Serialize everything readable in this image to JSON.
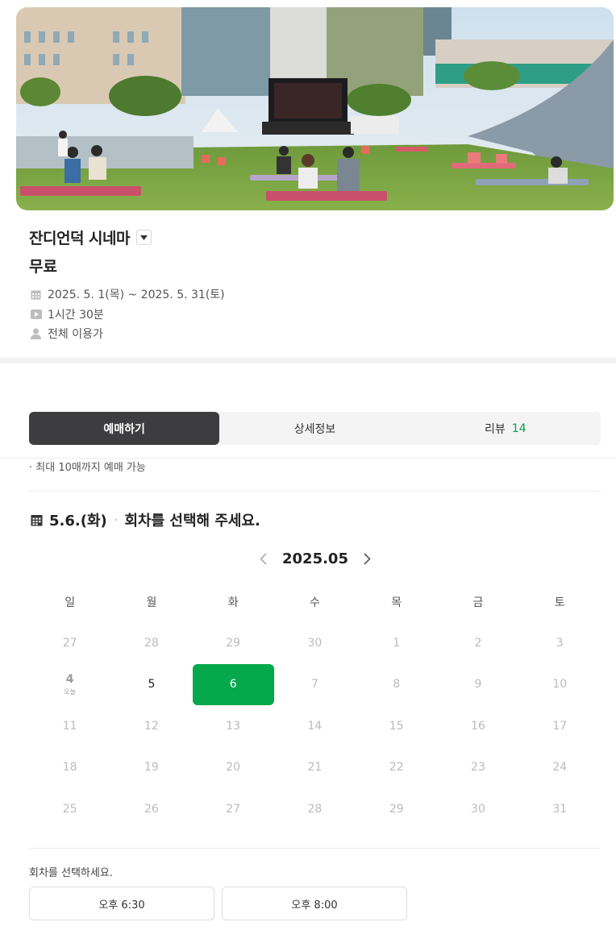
{
  "hero": {
    "image": "outdoor-cinema-lawn-photo"
  },
  "event": {
    "title": "잔디언덕 시네마",
    "price": "무료",
    "period": "2025. 5. 1(목) ~ 2025. 5. 31(토)",
    "runtime": "1시간 30분",
    "rating": "전체 이용가"
  },
  "tabs": [
    {
      "label": "예매하기",
      "active": true
    },
    {
      "label": "상세정보",
      "active": false
    },
    {
      "label": "리뷰",
      "count": "14",
      "active": false
    }
  ],
  "notice": "· 최대 10매까지 예매 가능",
  "selection": {
    "date": "5.6.(화)",
    "prompt": "회차를 선택해 주세요."
  },
  "calendar": {
    "month": "2025.05",
    "weekdays": [
      "일",
      "월",
      "화",
      "수",
      "목",
      "금",
      "토"
    ],
    "weeks": [
      [
        "27",
        "28",
        "29",
        "30",
        "1",
        "2",
        "3"
      ],
      [
        "4",
        "5",
        "6",
        "7",
        "8",
        "9",
        "10"
      ],
      [
        "11",
        "12",
        "13",
        "14",
        "15",
        "16",
        "17"
      ],
      [
        "18",
        "19",
        "20",
        "21",
        "22",
        "23",
        "24"
      ],
      [
        "25",
        "26",
        "27",
        "28",
        "29",
        "30",
        "31"
      ]
    ],
    "today_label": "오늘",
    "available": [
      "5",
      "6"
    ],
    "selected": "6",
    "accent": "#05a84a"
  },
  "sessions": {
    "label": "회차를 선택하세요.",
    "times": [
      "오후 6:30",
      "오후 8:00"
    ]
  }
}
